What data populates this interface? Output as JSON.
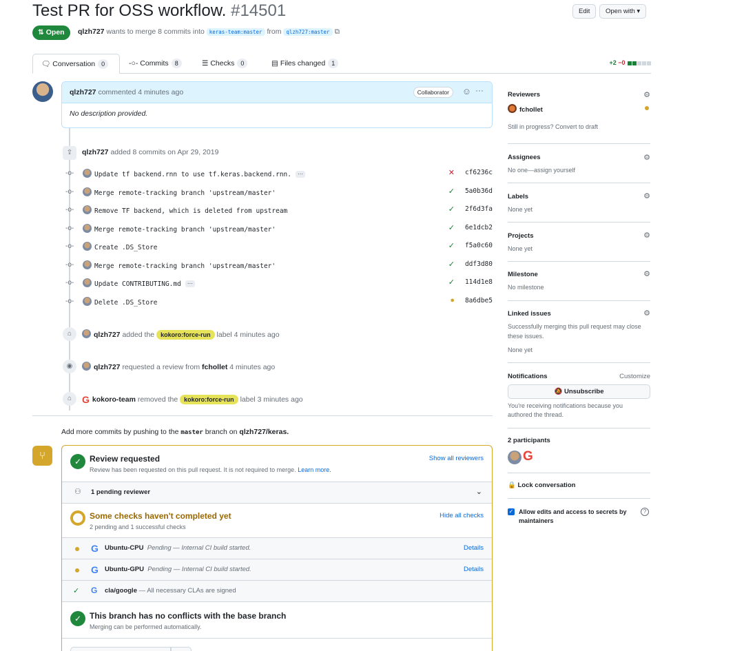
{
  "header": {
    "title": "Test PR for OSS workflow.",
    "number": "#14501",
    "edit_label": "Edit",
    "open_with_label": "Open with",
    "state": "Open",
    "author": "qlzh727",
    "merge_text": "wants to merge 8 commits into",
    "base_branch": "keras-team:master",
    "from_text": "from",
    "head_branch": "qlzh727:master"
  },
  "tabs": [
    {
      "label": "Conversation",
      "count": "0"
    },
    {
      "label": "Commits",
      "count": "8"
    },
    {
      "label": "Checks",
      "count": "0"
    },
    {
      "label": "Files changed",
      "count": "1"
    }
  ],
  "diffstat": {
    "additions": "+2",
    "deletions": "−0"
  },
  "comment": {
    "author": "qlzh727",
    "action": "commented 4 minutes ago",
    "badge": "Collaborator",
    "body": "No description provided."
  },
  "commits_event": {
    "author": "qlzh727",
    "text": "added 8 commits on Apr 29, 2019"
  },
  "commits": [
    {
      "message": "Update tf backend.rnn to use tf.keras.backend.rnn.",
      "sha": "cf6236c",
      "status": "fail",
      "more": true
    },
    {
      "message": "Merge remote-tracking branch 'upstream/master'",
      "sha": "5a0b36d",
      "status": "ok",
      "more": false
    },
    {
      "message": "Remove TF backend, which is deleted from upstream",
      "sha": "2f6d3fa",
      "status": "ok",
      "more": false
    },
    {
      "message": "Merge remote-tracking branch 'upstream/master'",
      "sha": "6e1dcb2",
      "status": "ok",
      "more": false
    },
    {
      "message": "Create .DS_Store",
      "sha": "f5a0c60",
      "status": "ok",
      "more": false
    },
    {
      "message": "Merge remote-tracking branch 'upstream/master'",
      "sha": "ddf3d80",
      "status": "ok",
      "more": false
    },
    {
      "message": "Update CONTRIBUTING.md",
      "sha": "114d1e8",
      "status": "ok",
      "more": true
    },
    {
      "message": "Delete .DS_Store",
      "sha": "8a6dbe5",
      "status": "pending",
      "more": false
    }
  ],
  "events": {
    "label_added": {
      "author": "qlzh727",
      "pre": "added the",
      "label": "kokoro:force-run",
      "post": "label 4 minutes ago"
    },
    "review_requested": {
      "author": "qlzh727",
      "pre": "requested a review from",
      "reviewer": "fchollet",
      "post": "4 minutes ago"
    },
    "label_removed": {
      "author": "kokoro-team",
      "pre": "removed the",
      "label": "kokoro:force-run",
      "post": "label 3 minutes ago"
    }
  },
  "add_more": {
    "pre": "Add more commits by pushing to the",
    "branch": "master",
    "mid": "branch on",
    "repo": "qlzh727/keras."
  },
  "merge_box": {
    "review_title": "Review requested",
    "review_sub": "Review has been requested on this pull request. It is not required to merge.",
    "learn_more": "Learn more.",
    "show_reviewers": "Show all reviewers",
    "pending_reviewer": "1 pending reviewer",
    "checks_title": "Some checks haven't completed yet",
    "checks_sub": "2 pending and 1 successful checks",
    "hide_checks": "Hide all checks",
    "checks": [
      {
        "name": "Ubuntu-CPU",
        "status": "Pending",
        "desc": "— Internal CI build started.",
        "details": "Details"
      },
      {
        "name": "Ubuntu-GPU",
        "status": "Pending",
        "desc": "— Internal CI build started.",
        "details": "Details"
      }
    ],
    "cla": {
      "name": "cla/google",
      "desc": "— All necessary CLAs are signed"
    },
    "conflict_title": "This branch has no conflicts with the base branch",
    "conflict_sub": "Merging can be performed automatically."
  },
  "sidebar": {
    "reviewers_head": "Reviewers",
    "reviewer": "fchollet",
    "draft_text": "Still in progress? Convert to draft",
    "assignees_head": "Assignees",
    "assignees_val": "No one—assign yourself",
    "labels_head": "Labels",
    "labels_val": "None yet",
    "projects_head": "Projects",
    "projects_val": "None yet",
    "milestone_head": "Milestone",
    "milestone_val": "No milestone",
    "linked_head": "Linked issues",
    "linked_desc_1": "Successfully merging this pull request may close",
    "linked_desc_2": "these issues.",
    "linked_val": "None yet",
    "notifications_head": "Notifications",
    "customize": "Customize",
    "unsubscribe": "Unsubscribe",
    "notif_desc_1": "You're receiving notifications because you",
    "notif_desc_2": "authored the thread.",
    "participants_head": "2 participants",
    "lock": "Lock conversation",
    "allow_edits_1": "Allow edits and access to secrets by",
    "allow_edits_2": "maintainers"
  }
}
